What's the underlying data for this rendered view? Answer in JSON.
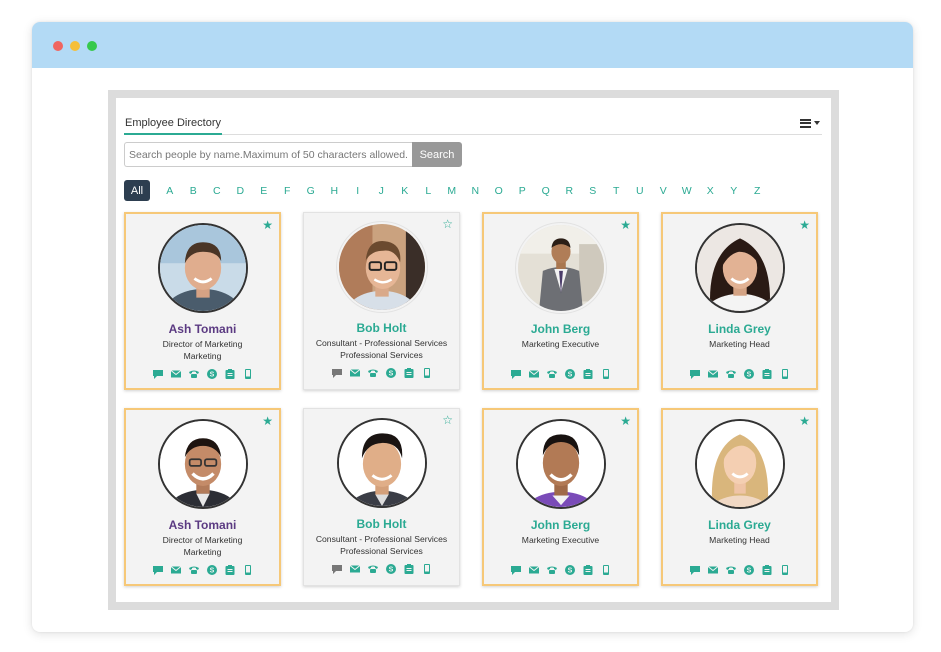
{
  "window": {
    "controls": [
      "close",
      "minimize",
      "maximize"
    ],
    "colors": {
      "titlebar": "#b3daf5",
      "close": "#f0655f",
      "minimize": "#f5bf39",
      "maximize": "#37c94b"
    }
  },
  "directory": {
    "tab_label": "Employee Directory",
    "view_toggle_icon": "list-icon",
    "search": {
      "placeholder": "Search people by name.Maximum of 50 characters allowed.",
      "value": "",
      "button_label": "Search"
    },
    "alphabet": {
      "all_label": "All",
      "letters": [
        "A",
        "B",
        "C",
        "D",
        "E",
        "F",
        "G",
        "H",
        "I",
        "J",
        "K",
        "L",
        "M",
        "N",
        "O",
        "P",
        "Q",
        "R",
        "S",
        "T",
        "U",
        "V",
        "W",
        "X",
        "Y",
        "Z"
      ]
    },
    "accent_color": "#2baa93",
    "favorite_border_color": "#f6c878",
    "action_icons": [
      "chat-icon",
      "email-icon",
      "phone-icon",
      "skype-icon",
      "directory-icon",
      "mobile-icon"
    ],
    "employees": [
      {
        "name": "Ash Tomani",
        "title": "Director of Marketing",
        "department": "Marketing",
        "favorite": true,
        "name_color": "#5b3a82"
      },
      {
        "name": "Bob Holt",
        "title": "Consultant - Professional Services",
        "department": "Professional Services",
        "favorite": false,
        "name_color": "#2baa93"
      },
      {
        "name": "John Berg",
        "title": "Marketing Executive",
        "department": "",
        "favorite": true,
        "name_color": "#2baa93"
      },
      {
        "name": "Linda Grey",
        "title": "Marketing Head",
        "department": "",
        "favorite": true,
        "name_color": "#2baa93"
      },
      {
        "name": "Ash Tomani",
        "title": "Director of Marketing",
        "department": "Marketing",
        "favorite": true,
        "name_color": "#5b3a82"
      },
      {
        "name": "Bob Holt",
        "title": "Consultant - Professional Services",
        "department": "Professional Services",
        "favorite": false,
        "name_color": "#2baa93"
      },
      {
        "name": "John Berg",
        "title": "Marketing Executive",
        "department": "",
        "favorite": true,
        "name_color": "#2baa93"
      },
      {
        "name": "Linda Grey",
        "title": "Marketing Head",
        "department": "",
        "favorite": true,
        "name_color": "#2baa93"
      }
    ]
  }
}
